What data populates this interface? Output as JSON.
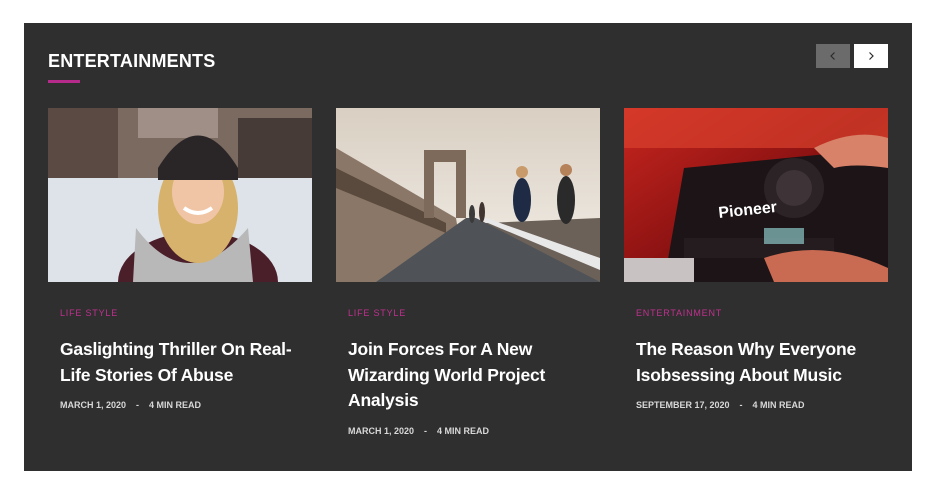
{
  "section": {
    "title": "ENTERTAINMENTS",
    "prev_icon": "chevron-left-icon",
    "next_icon": "chevron-right-icon"
  },
  "colors": {
    "panel_bg": "#2f2f2f",
    "accent": "#c0308f",
    "title": "#ffffff"
  },
  "cards": [
    {
      "category": "LIFE STYLE",
      "title": "Gaslighting Thriller On Real-Life Stories Of Abuse",
      "date": "MARCH 1, 2020",
      "separator": "-",
      "read_time": "4 MIN READ"
    },
    {
      "category": "LIFE STYLE",
      "title": "Join Forces For A New Wizarding World Project Analysis",
      "date": "MARCH 1, 2020",
      "separator": "-",
      "read_time": "4 MIN READ"
    },
    {
      "category": "ENTERTAINMENT",
      "title": "The Reason Why Everyone Isobsessing About Music",
      "date": "SEPTEMBER 17, 2020",
      "separator": "-",
      "read_time": "4 MIN READ",
      "image_brand": "Pioneer"
    }
  ]
}
